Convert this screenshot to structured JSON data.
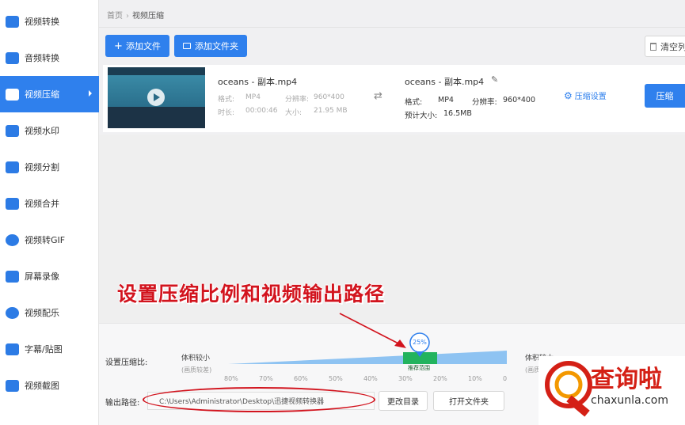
{
  "sidebar": {
    "items": [
      {
        "label": "视频转换",
        "icon": "video-convert-icon"
      },
      {
        "label": "音频转换",
        "icon": "audio-convert-icon"
      },
      {
        "label": "视频压缩",
        "icon": "video-compress-icon",
        "active": true
      },
      {
        "label": "视频水印",
        "icon": "video-watermark-icon"
      },
      {
        "label": "视频分割",
        "icon": "video-split-icon"
      },
      {
        "label": "视频合并",
        "icon": "video-merge-icon"
      },
      {
        "label": "视频转GIF",
        "icon": "video-gif-icon"
      },
      {
        "label": "屏幕录像",
        "icon": "screen-record-icon"
      },
      {
        "label": "视频配乐",
        "icon": "video-music-icon"
      },
      {
        "label": "字幕/贴图",
        "icon": "subtitle-sticker-icon"
      },
      {
        "label": "视频截图",
        "icon": "video-screenshot-icon"
      }
    ]
  },
  "breadcrumb": {
    "home": "首页",
    "separator": "›",
    "current": "视频压缩"
  },
  "toolbar": {
    "add_file": "添加文件",
    "add_folder": "添加文件夹",
    "clear": "清空列"
  },
  "file": {
    "source_name": "oceans - 副本.mp4",
    "format_label": "格式:",
    "format_value": "MP4",
    "resolution_label": "分辨率:",
    "resolution_value": "960*400",
    "duration_label": "时长:",
    "duration_value": "00:00:46",
    "size_label": "大小:",
    "size_value": "21.95 MB",
    "output_name": "oceans - 副本.mp4",
    "out_format_label": "格式:",
    "out_format_value": "MP4",
    "out_resolution_label": "分辨率:",
    "out_resolution_value": "960*400",
    "estimate_label": "预计大小:",
    "estimate_value": "16.5MB",
    "settings_label": "压缩设置",
    "compress_label": "压缩"
  },
  "compression": {
    "ratio_label": "设置压缩比:",
    "left_title": "体积较小",
    "left_sub": "(画质较差)",
    "right_title": "体积较大",
    "right_sub": "(画质",
    "current_value": "25%",
    "recommend_label": "推荐范围",
    "ticks": [
      "80%",
      "70%",
      "60%",
      "50%",
      "40%",
      "30%",
      "20%",
      "10%",
      "0"
    ]
  },
  "output": {
    "label": "输出路径:",
    "path": "C:\\Users\\Administrator\\Desktop\\迅捷视频转换器",
    "change_dir": "更改目录",
    "open_folder": "打开文件夹"
  },
  "annotation": {
    "text": "设置压缩比例和视频输出路径"
  },
  "watermark": {
    "cn": "查询啦",
    "en": "chaxunla.com"
  },
  "colors": {
    "accent": "#2f80ed",
    "annotation_red": "#d2141e",
    "recommend_green": "#22b35e"
  }
}
